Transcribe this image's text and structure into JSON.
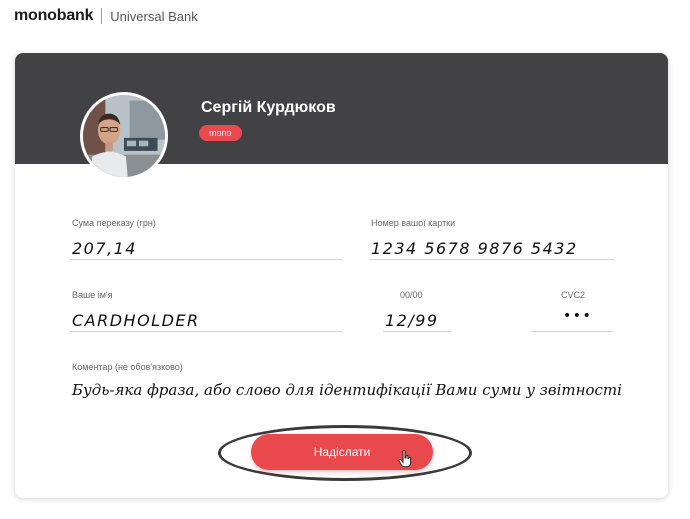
{
  "brand": {
    "name": "monobank",
    "subtitle": "Universal Bank"
  },
  "user": {
    "name": "Сергій Курдюков",
    "badge": "mono"
  },
  "form": {
    "amount": {
      "label": "Сума переказу (грн)",
      "value": "207,14"
    },
    "card_number": {
      "label": "Номер вашої картки",
      "value": "1234 5678 9876 5432"
    },
    "name": {
      "label": "Ваше ім'я",
      "value": "CARDHOLDER"
    },
    "expiry": {
      "label": "00/00",
      "value": "12/99"
    },
    "cvc": {
      "label": "CVC2",
      "value": "•••"
    },
    "comment": {
      "label": "Коментар (не обов'язково)",
      "value": "Будь-яка фраза, або слово для ідентифікації Вами суми у звітності"
    },
    "submit_label": "Надіслати"
  },
  "colors": {
    "header": "#424244",
    "accent": "#e9484c"
  },
  "icons": {
    "cursor": "hand-pointer-icon"
  }
}
